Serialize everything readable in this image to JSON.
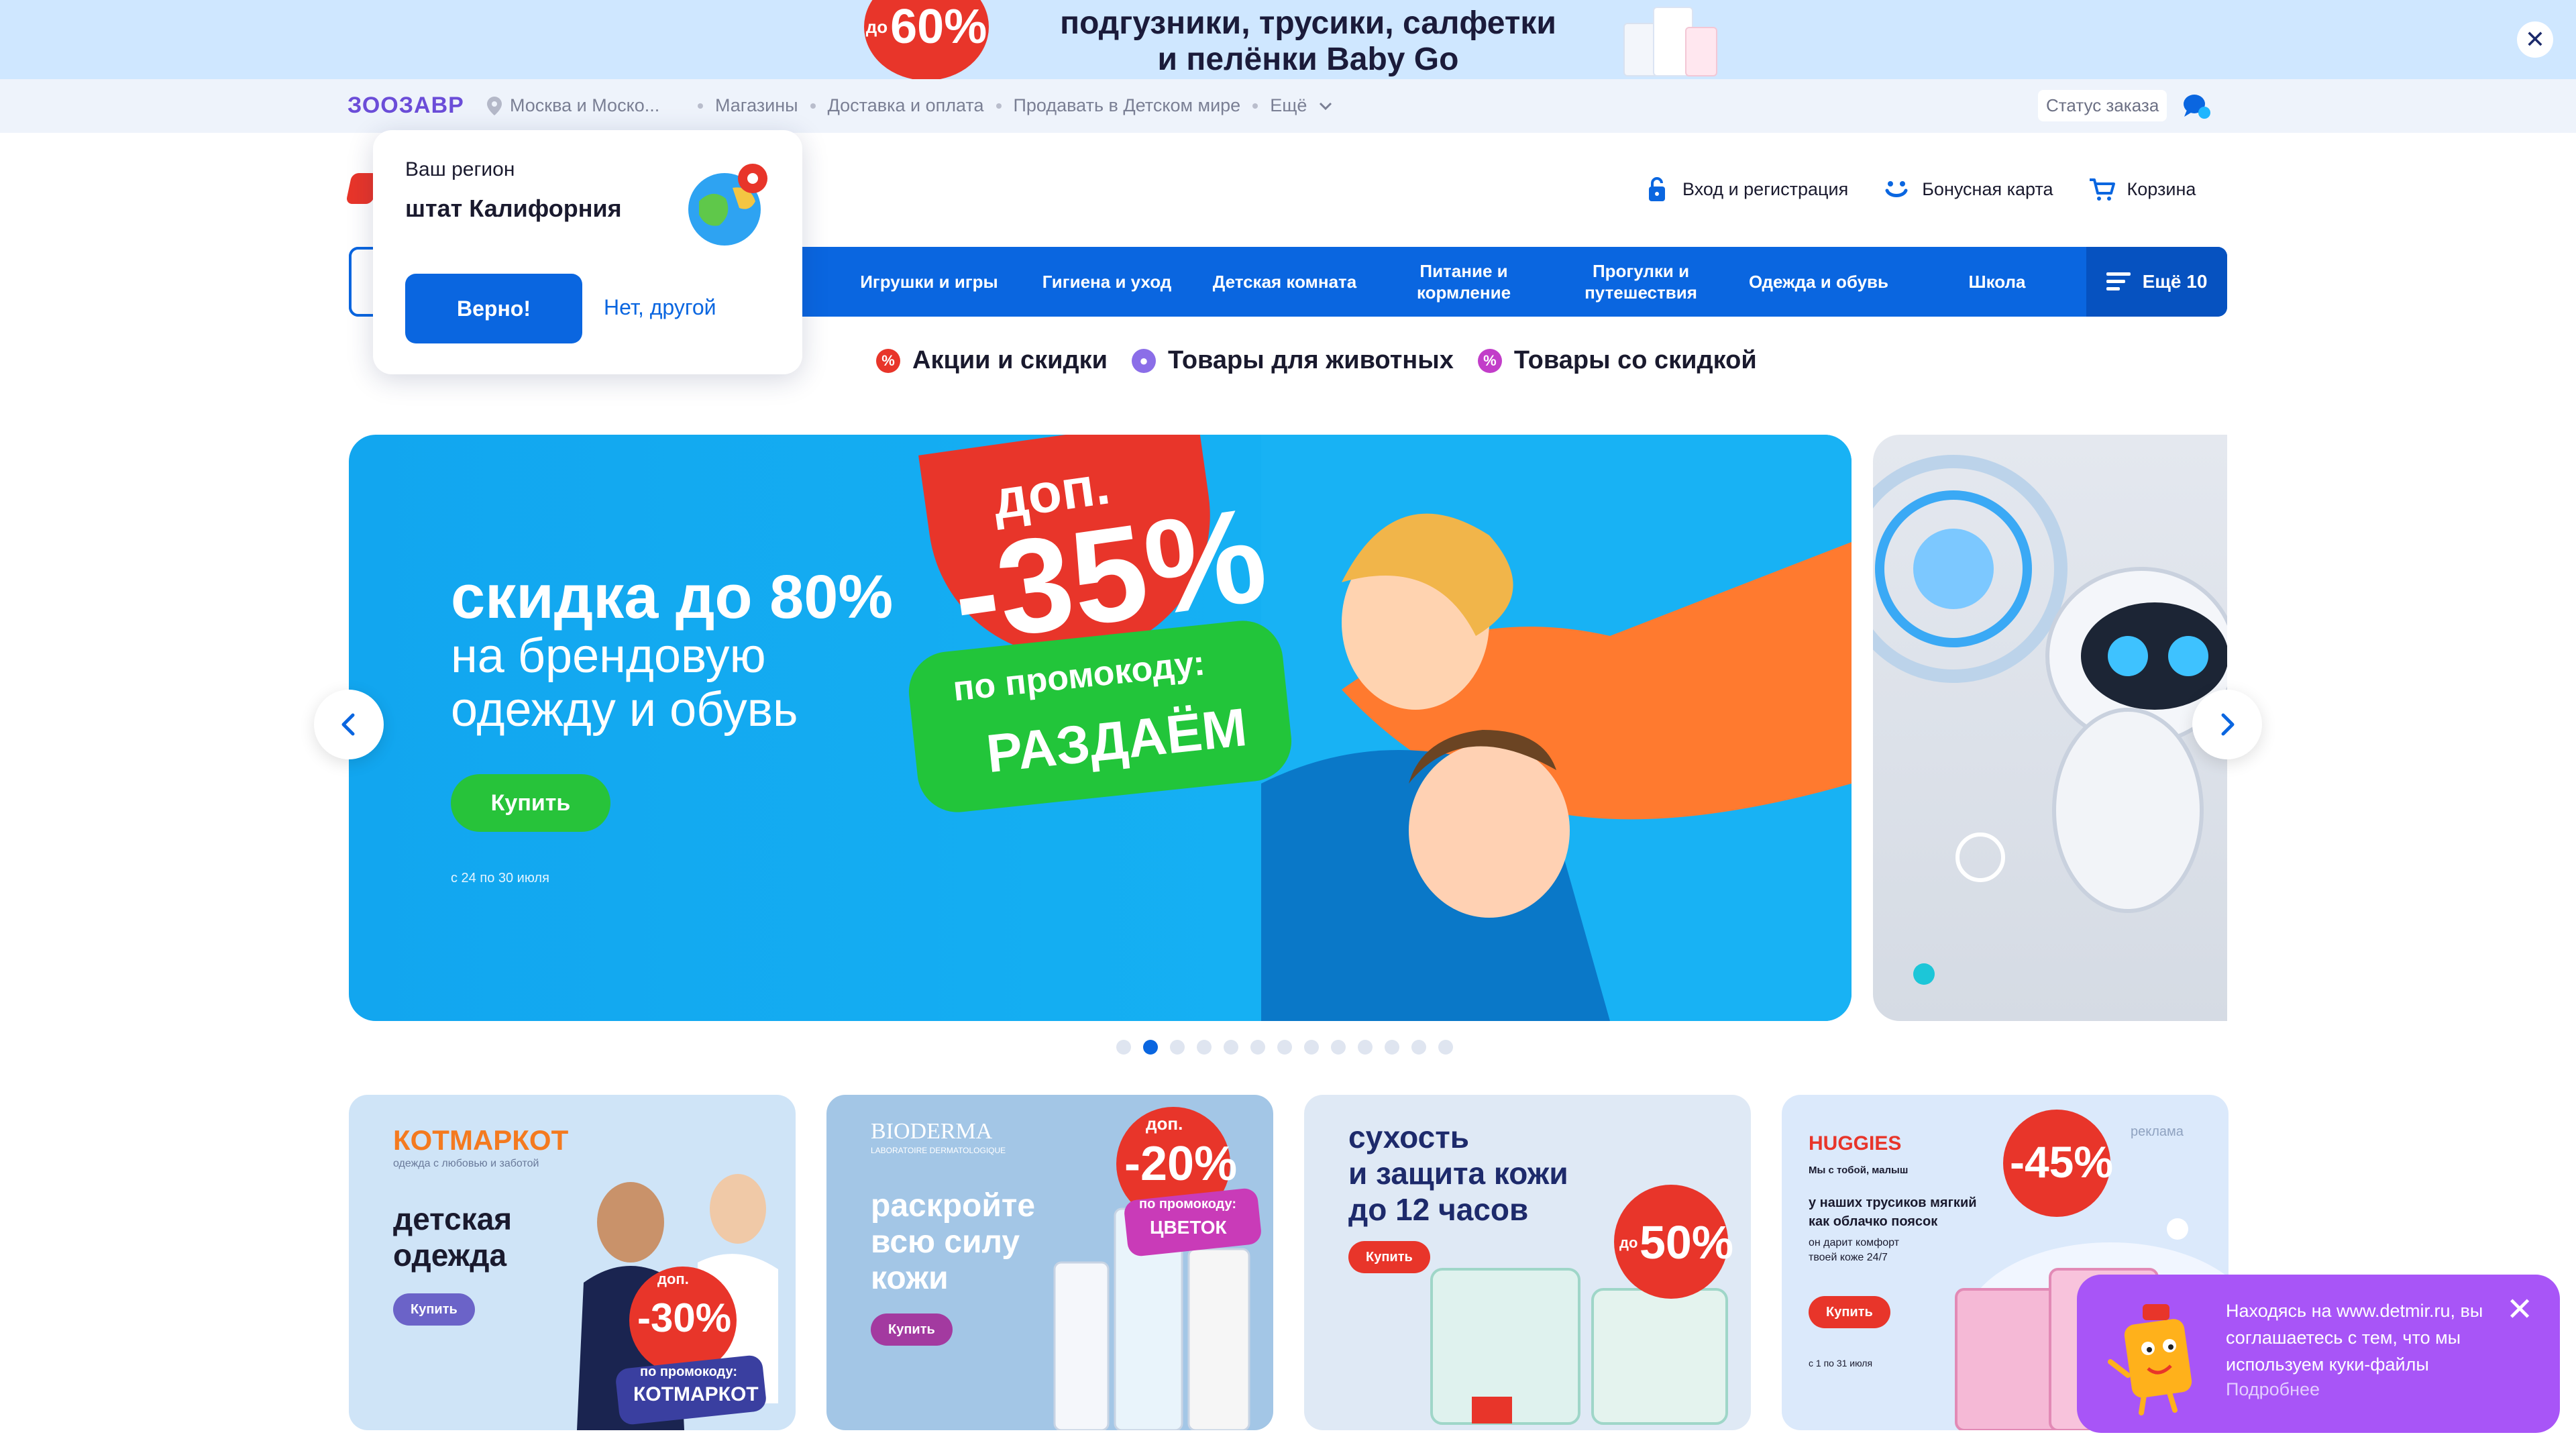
{
  "promo_top": {
    "badge_prefix": "до",
    "badge_value": "60%",
    "line1": "подгузники, трусики, салфетки",
    "line2": "и пелёнки Baby Go",
    "close": "✕"
  },
  "subnav": {
    "logo": "ЗООЗАВР",
    "location": "Москва и Моско...",
    "links": [
      "Магазины",
      "Доставка и оплата",
      "Продавать в Детском мире",
      "Ещё"
    ],
    "order_status": "Статус заказа"
  },
  "header": {
    "login": "Вход и регистрация",
    "bonus": "Бонусная карта",
    "cart": "Корзина"
  },
  "categories": {
    "items": [
      "Игрушки и игры",
      "Гигиена и уход",
      "Детская комната",
      "Питание и кормление",
      "Прогулки и путешествия",
      "Одежда и обувь",
      "Школа"
    ],
    "more": "Ещё 10"
  },
  "quick_links": [
    "Акции и скидки",
    "Товары для животных",
    "Товары со скидкой"
  ],
  "region_popup": {
    "label": "Ваш регион",
    "value": "штат Калифорния",
    "confirm": "Верно!",
    "change": "Нет, другой"
  },
  "hero": {
    "title": "скидка до 80%",
    "sub1": "на брендовую",
    "sub2": "одежду и обувь",
    "buy": "Купить",
    "dates": "с 24 по 30 июля",
    "extra": "доп.",
    "discount": "-35%",
    "promo_label": "по промокоду:",
    "promo_code": "РАЗДАЁМ"
  },
  "slider": {
    "count": 13,
    "active": 1
  },
  "cards": [
    {
      "brand": "КОТМАРКОТ",
      "tagline": "одежда с любовью и заботой",
      "title1": "детская",
      "title2": "одежда",
      "btn": "Купить",
      "extra": "доп.",
      "discount": "-30%",
      "promo_label": "по промокоду:",
      "promo_code": "КОТМАРКОТ"
    },
    {
      "brand": "BIODERMA",
      "tagline": "LABORATOIRE DERMATOLOGIQUE",
      "title1": "раскройте",
      "title2": "всю силу",
      "title3": "кожи",
      "btn": "Купить",
      "extra": "доп.",
      "discount": "-20%",
      "promo_label": "по промокоду:",
      "promo_code": "ЦВЕТОК"
    },
    {
      "title1": "сухость",
      "title2": "и защита кожи",
      "title3": "до 12 часов",
      "btn": "Купить",
      "discount_prefix": "до",
      "discount": "50%"
    },
    {
      "brand": "HUGGIES",
      "ad": "реклама",
      "tagline": "Мы с тобой, малыш",
      "title1": "у наших трусиков мягкий",
      "title2": "как облачко поясок",
      "note": "он дарит комфорт твоей коже 24/7",
      "btn": "Купить",
      "dates": "с 1 по 31 июля",
      "discount": "-45%"
    }
  ],
  "cookie": {
    "message": "Находясь на www.detmir.ru, вы соглашаетесь с тем, что мы используем куки-файлы",
    "more": "Подробнее",
    "close": "✕"
  },
  "colors": {
    "primary": "#0a66e0",
    "accent_red": "#e8352a",
    "green": "#27c33a",
    "cookie_bg": "#a855f7"
  }
}
